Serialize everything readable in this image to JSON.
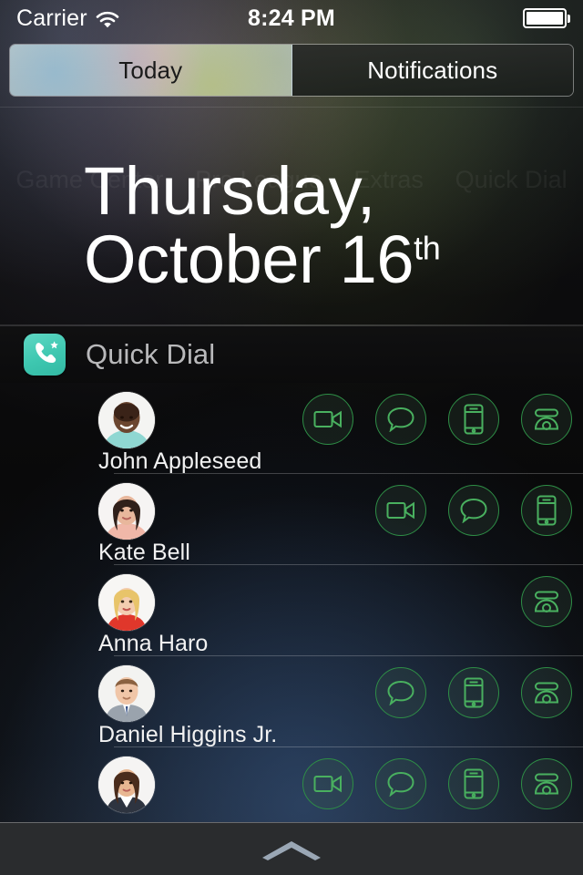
{
  "status_bar": {
    "carrier": "Carrier",
    "wifi_icon": "wifi-icon",
    "time": "8:24 PM",
    "battery_icon": "battery-full-icon"
  },
  "segmented_control": {
    "tabs": [
      {
        "label": "Today",
        "selected": true
      },
      {
        "label": "Notifications",
        "selected": false
      }
    ]
  },
  "ghost_labels": [
    "Game Center",
    "Pro League",
    "Extras",
    "Quick Dial"
  ],
  "date": {
    "line1": "Thursday,",
    "day_month": "October 16",
    "ordinal": "th"
  },
  "widget": {
    "icon": "quick-dial-app-icon",
    "title": "Quick Dial"
  },
  "contacts": [
    {
      "name": "John Appleseed",
      "avatar": "avatar-john-appleseed",
      "actions": [
        "video-call-icon",
        "message-icon",
        "mobile-phone-icon",
        "landline-phone-icon"
      ]
    },
    {
      "name": "Kate Bell",
      "avatar": "avatar-kate-bell",
      "actions": [
        "video-call-icon",
        "message-icon",
        "mobile-phone-icon"
      ]
    },
    {
      "name": "Anna Haro",
      "avatar": "avatar-anna-haro",
      "actions": [
        "landline-phone-icon"
      ]
    },
    {
      "name": "Daniel Higgins Jr.",
      "avatar": "avatar-daniel-higgins",
      "actions": [
        "message-icon",
        "mobile-phone-icon",
        "landline-phone-icon"
      ]
    },
    {
      "name": "",
      "avatar": "avatar-fifth-contact",
      "actions": [
        "video-call-icon",
        "message-icon",
        "mobile-phone-icon",
        "landline-phone-icon"
      ]
    }
  ],
  "bottom_bar": {
    "grabber_icon": "chevron-up-grabber-icon"
  },
  "colors": {
    "accent_green": "#49b05f",
    "ring_green": "#2e8e46",
    "app_icon_teal": "#3ec7b0",
    "background": "#0c0c0d",
    "text_primary": "#f2f2f2",
    "text_secondary": "#b9b9bb"
  }
}
